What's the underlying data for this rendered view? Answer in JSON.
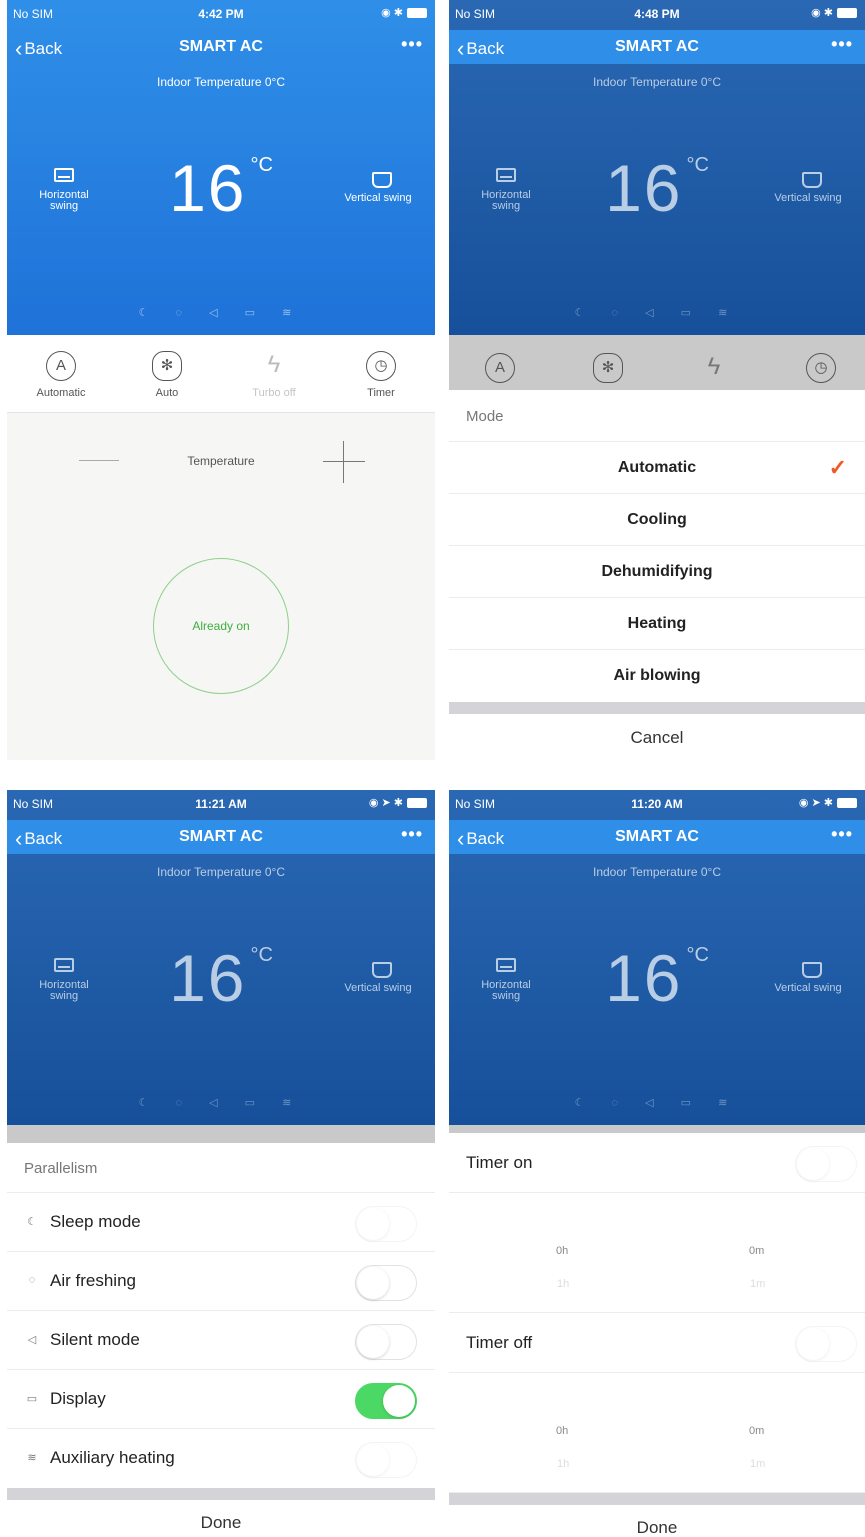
{
  "nav": {
    "back_label": "Back",
    "title": "SMART AC",
    "more": "•••"
  },
  "status": {
    "carrier": "No SIM",
    "wifi": "wifi-icon",
    "bluetooth": "bluetooth-icon"
  },
  "screens": [
    {
      "time": "4:42 PM"
    },
    {
      "time": "4:48 PM"
    },
    {
      "time": "11:21 AM"
    },
    {
      "time": "11:20 AM"
    }
  ],
  "hero": {
    "indoor": "Indoor Temperature 0°C",
    "horizontal_swing": "Horizontal swing",
    "vertical_swing": "Vertical swing",
    "temperature": "16",
    "unit": "°C",
    "function_icons": [
      "sleep-icon",
      "fresh-icon",
      "silent-icon",
      "display-icon",
      "heat-icon"
    ]
  },
  "modebar": {
    "mode": "Automatic",
    "fan": "Auto",
    "turbo": "Turbo off",
    "timer": "Timer"
  },
  "control": {
    "temperature_label": "Temperature",
    "power_status": "Already on"
  },
  "mode_sheet": {
    "title": "Mode",
    "options": [
      "Automatic",
      "Cooling",
      "Dehumidifying",
      "Heating",
      "Air blowing"
    ],
    "selected": "Automatic",
    "cancel": "Cancel"
  },
  "parallel_sheet": {
    "title": "Parallelism",
    "items": [
      {
        "label": "Sleep mode",
        "on": false
      },
      {
        "label": "Air freshing",
        "on": false
      },
      {
        "label": "Silent mode",
        "on": false
      },
      {
        "label": "Display",
        "on": true
      },
      {
        "label": "Auxiliary heating",
        "on": false
      }
    ],
    "done": "Done"
  },
  "timer_sheet": {
    "timer_on": "Timer on",
    "timer_off": "Timer off",
    "hours": [
      "0h",
      "1h"
    ],
    "minutes": [
      "0m",
      "1m"
    ],
    "done": "Done"
  },
  "colors": {
    "accent": "#1f72d8",
    "check": "#f05a24",
    "toggle_on": "#4cd864",
    "power_ring": "#8ed08a"
  }
}
